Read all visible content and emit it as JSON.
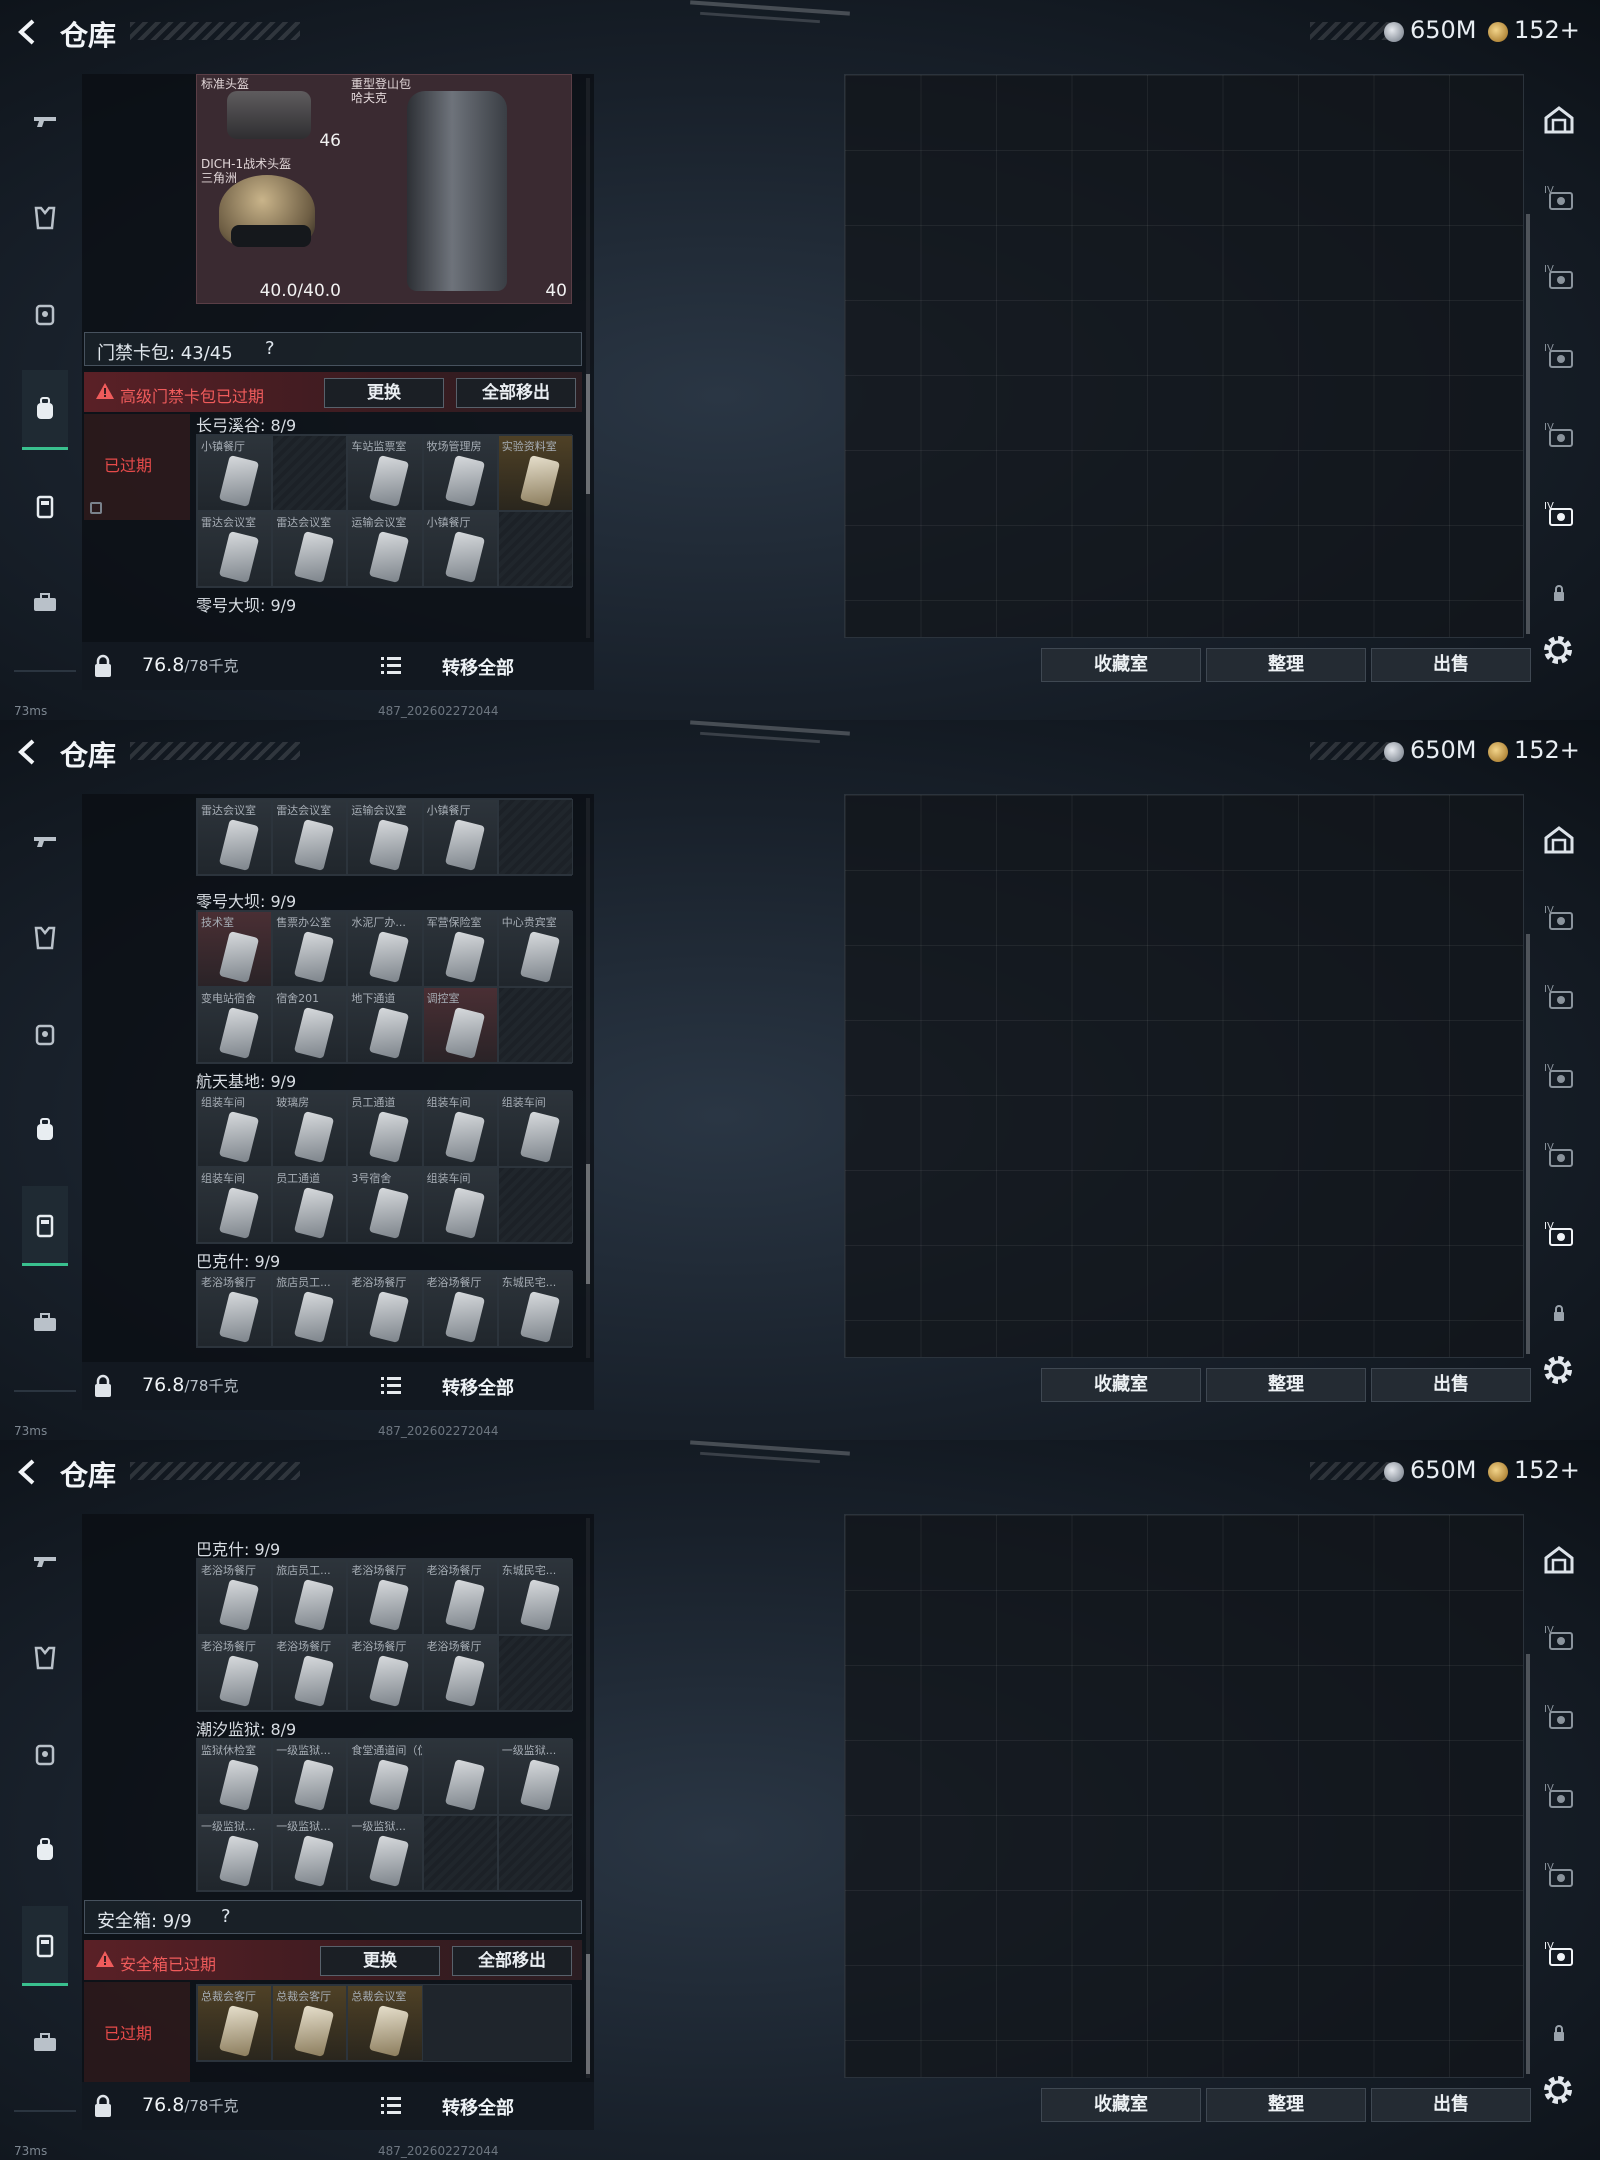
{
  "header": {
    "title": "仓库",
    "currency_silver": "650M",
    "currency_gold": "152+"
  },
  "icons": {
    "back": "back-arrow-icon",
    "silver": "silver-coin-icon",
    "gold": "gold-coin-icon",
    "left_nav": [
      "gun-icon",
      "armor-icon",
      "vest-icon",
      "backpack-icon",
      "case-icon",
      "toolbox-icon"
    ],
    "right_nav": [
      "warehouse-icon",
      "storage-iv-1-icon",
      "storage-iv-2-icon",
      "storage-iv-3-icon",
      "storage-iv-4-icon",
      "storage-iv-5-icon",
      "lock-icon"
    ],
    "settings": "gear-icon"
  },
  "panels": [
    {
      "active_nav": 3,
      "equipment": {
        "items": [
          {
            "name": "标准头盔",
            "value": "46"
          },
          {
            "name": "重型登山包\n哈夫克",
            "value": "40"
          },
          {
            "name": "DICH-1战术头盔\n三角洲",
            "value": "40.0/40.0"
          }
        ]
      },
      "section": {
        "title": "门禁卡包: 43/45",
        "help": "?",
        "warning": "高级门禁卡包已过期",
        "btn_replace": "更换",
        "btn_remove_all": "全部移出",
        "expired_tag": "已过期"
      },
      "areas": [
        {
          "title": "长弓溪谷: 8/9",
          "cards": [
            {
              "label": "小镇餐厅",
              "tone": "c-grey"
            },
            {
              "label": "",
              "tone": "c-empty"
            },
            {
              "label": "车站监票室",
              "tone": "c-grey"
            },
            {
              "label": "牧场管理房",
              "tone": "c-grey"
            },
            {
              "label": "实验资料室",
              "tone": "c-gold"
            },
            {
              "label": "雷达会议室",
              "tone": "c-grey"
            },
            {
              "label": "雷达会议室",
              "tone": "c-grey"
            },
            {
              "label": "运输会议室",
              "tone": "c-grey"
            },
            {
              "label": "小镇餐厅",
              "tone": "c-grey"
            },
            {
              "label": "",
              "tone": "c-empty"
            }
          ]
        },
        {
          "title": "零号大坝: 9/9",
          "cards": []
        }
      ],
      "footer": {
        "weight": "76.8",
        "weight_max": "/78千克",
        "transfer_all": "转移全部"
      },
      "buttons": {
        "collection": "收藏室",
        "organize": "整理",
        "sell": "出售"
      },
      "status": {
        "ping": "73ms",
        "build": "487_202602272044"
      }
    },
    {
      "active_nav": 4,
      "areas": [
        {
          "title": "",
          "cards": [
            {
              "label": "雷达会议室",
              "tone": "c-grey"
            },
            {
              "label": "雷达会议室",
              "tone": "c-grey"
            },
            {
              "label": "运输会议室",
              "tone": "c-grey"
            },
            {
              "label": "小镇餐厅",
              "tone": "c-grey"
            },
            {
              "label": "",
              "tone": "c-empty"
            }
          ]
        },
        {
          "title": "零号大坝: 9/9",
          "cards": [
            {
              "label": "技术室",
              "tone": "c-red"
            },
            {
              "label": "售票办公室",
              "tone": "c-grey"
            },
            {
              "label": "水泥厂办...",
              "tone": "c-grey"
            },
            {
              "label": "军营保险室",
              "tone": "c-grey"
            },
            {
              "label": "中心贵宾室",
              "tone": "c-grey"
            },
            {
              "label": "变电站宿舍",
              "tone": "c-grey"
            },
            {
              "label": "宿舍201",
              "tone": "c-grey"
            },
            {
              "label": "地下通道",
              "tone": "c-grey"
            },
            {
              "label": "调控室",
              "tone": "c-red"
            },
            {
              "label": "",
              "tone": "c-empty"
            }
          ]
        },
        {
          "title": "航天基地: 9/9",
          "cards": [
            {
              "label": "组装车间",
              "tone": "c-grey"
            },
            {
              "label": "玻璃房",
              "tone": "c-grey"
            },
            {
              "label": "员工通道",
              "tone": "c-grey"
            },
            {
              "label": "组装车间",
              "tone": "c-grey"
            },
            {
              "label": "组装车间",
              "tone": "c-grey"
            },
            {
              "label": "组装车间",
              "tone": "c-grey"
            },
            {
              "label": "员工通道",
              "tone": "c-grey"
            },
            {
              "label": "3号宿舍",
              "tone": "c-grey"
            },
            {
              "label": "组装车间",
              "tone": "c-grey"
            },
            {
              "label": "",
              "tone": "c-empty"
            }
          ]
        },
        {
          "title": "巴克什: 9/9",
          "cards": [
            {
              "label": "老浴场餐厅",
              "tone": "c-grey"
            },
            {
              "label": "旅店员工...",
              "tone": "c-grey"
            },
            {
              "label": "老浴场餐厅",
              "tone": "c-grey"
            },
            {
              "label": "老浴场餐厅",
              "tone": "c-grey"
            },
            {
              "label": "东城民宅...",
              "tone": "c-grey"
            }
          ]
        }
      ],
      "footer": {
        "weight": "76.8",
        "weight_max": "/78千克",
        "transfer_all": "转移全部"
      },
      "buttons": {
        "collection": "收藏室",
        "organize": "整理",
        "sell": "出售"
      },
      "status": {
        "ping": "73ms",
        "build": "487_202602272044"
      }
    },
    {
      "active_nav": 4,
      "areas": [
        {
          "title": "巴克什: 9/9",
          "cards": [
            {
              "label": "老浴场餐厅",
              "tone": "c-grey"
            },
            {
              "label": "旅店员工...",
              "tone": "c-grey"
            },
            {
              "label": "老浴场餐厅",
              "tone": "c-grey"
            },
            {
              "label": "老浴场餐厅",
              "tone": "c-grey"
            },
            {
              "label": "东城民宅...",
              "tone": "c-grey"
            },
            {
              "label": "老浴场餐厅",
              "tone": "c-grey"
            },
            {
              "label": "老浴场餐厅",
              "tone": "c-grey"
            },
            {
              "label": "老浴场餐厅",
              "tone": "c-grey"
            },
            {
              "label": "老浴场餐厅",
              "tone": "c-grey"
            },
            {
              "label": "",
              "tone": "c-empty"
            }
          ]
        },
        {
          "title": "潮汐监狱: 8/9",
          "cards": [
            {
              "label": "监狱休检室",
              "tone": "c-grey"
            },
            {
              "label": "一级监狱...",
              "tone": "c-grey"
            },
            {
              "label": "食堂通道间（仿制）",
              "tone": "c-grey"
            },
            {
              "label": "",
              "tone": "c-grey"
            },
            {
              "label": "一级监狱...",
              "tone": "c-grey"
            },
            {
              "label": "一级监狱...",
              "tone": "c-grey"
            },
            {
              "label": "一级监狱...",
              "tone": "c-grey"
            },
            {
              "label": "一级监狱...",
              "tone": "c-grey"
            },
            {
              "label": "",
              "tone": "c-empty"
            },
            {
              "label": "",
              "tone": "c-empty"
            }
          ]
        }
      ],
      "section": {
        "title": "安全箱: 9/9",
        "help": "?",
        "warning": "安全箱已过期",
        "btn_replace": "更换",
        "btn_remove_all": "全部移出",
        "expired_tag": "已过期"
      },
      "bottom_cards": [
        {
          "label": "总裁会客厅",
          "tone": "c-gold"
        },
        {
          "label": "总裁会客厅",
          "tone": "c-gold"
        },
        {
          "label": "总裁会议室",
          "tone": "c-gold"
        }
      ],
      "footer": {
        "weight": "76.8",
        "weight_max": "/78千克",
        "transfer_all": "转移全部"
      },
      "buttons": {
        "collection": "收藏室",
        "organize": "整理",
        "sell": "出售"
      },
      "status": {
        "ping": "73ms",
        "build": "487_202602272044"
      }
    }
  ]
}
